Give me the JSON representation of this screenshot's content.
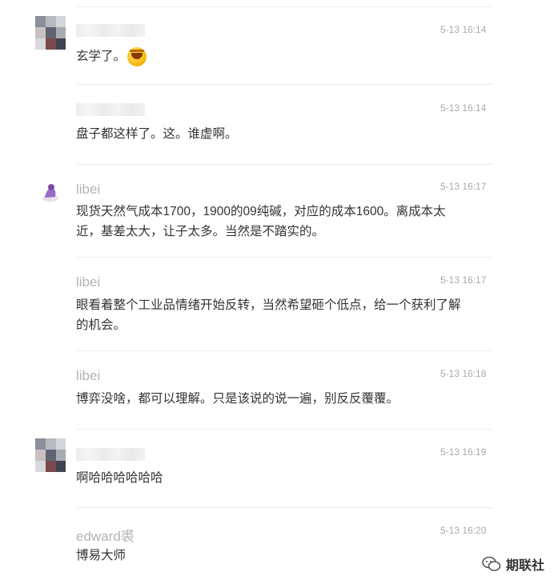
{
  "comments": [
    {
      "name": "",
      "time": "5-13 16:14",
      "text": "玄学了。"
    },
    {
      "name": "",
      "time": "5-13 16:14",
      "text": "盘子都这样了。这。谁虚啊。"
    },
    {
      "name": "libei",
      "time": "5-13 16:17",
      "text": "现货天然气成本1700，1900的09纯碱，对应的成本1600。离成本太近，基差太大，让子太多。当然是不踏实的。"
    },
    {
      "name": "libei",
      "time": "5-13 16:17",
      "text": "眼看着整个工业品情绪开始反转，当然希望砸个低点，给一个获利了解的机会。"
    },
    {
      "name": "libei",
      "time": "5-13 16:18",
      "text": "博弈没啥，都可以理解。只是该说的说一遍，别反反覆覆。"
    },
    {
      "name": "",
      "time": "5-13 16:19",
      "text": "啊哈哈哈哈哈哈"
    },
    {
      "name": "edward裘",
      "time": "5-13 16:20",
      "text": "博易大师"
    }
  ],
  "brand": {
    "text": "期联社"
  },
  "icons": {
    "emoji": "laughing-crying-emoji-icon",
    "brand": "wechat-brand-icon"
  }
}
